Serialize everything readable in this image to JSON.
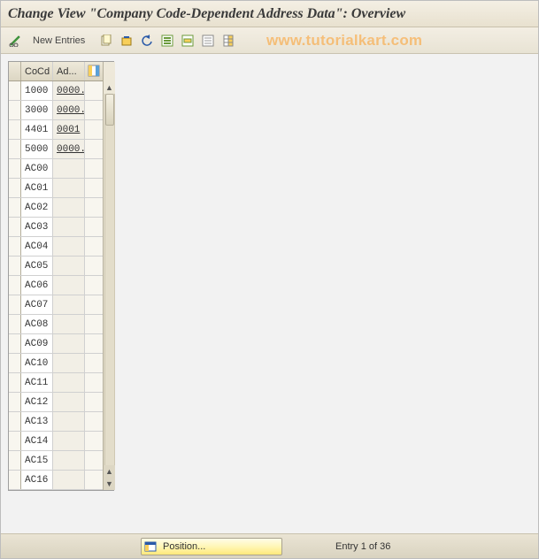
{
  "title": "Change View \"Company Code-Dependent Address Data\": Overview",
  "watermark": "www.tutorialkart.com",
  "toolbar": {
    "new_entries_label": "New Entries"
  },
  "table": {
    "columns": {
      "sel": "",
      "cocd": "CoCd",
      "ad": "Ad..."
    },
    "rows": [
      {
        "cocd": "1000",
        "ad": "0000."
      },
      {
        "cocd": "3000",
        "ad": "0000."
      },
      {
        "cocd": "4401",
        "ad": "0001"
      },
      {
        "cocd": "5000",
        "ad": "0000."
      },
      {
        "cocd": "AC00",
        "ad": ""
      },
      {
        "cocd": "AC01",
        "ad": ""
      },
      {
        "cocd": "AC02",
        "ad": ""
      },
      {
        "cocd": "AC03",
        "ad": ""
      },
      {
        "cocd": "AC04",
        "ad": ""
      },
      {
        "cocd": "AC05",
        "ad": ""
      },
      {
        "cocd": "AC06",
        "ad": ""
      },
      {
        "cocd": "AC07",
        "ad": ""
      },
      {
        "cocd": "AC08",
        "ad": ""
      },
      {
        "cocd": "AC09",
        "ad": ""
      },
      {
        "cocd": "AC10",
        "ad": ""
      },
      {
        "cocd": "AC11",
        "ad": ""
      },
      {
        "cocd": "AC12",
        "ad": ""
      },
      {
        "cocd": "AC13",
        "ad": ""
      },
      {
        "cocd": "AC14",
        "ad": ""
      },
      {
        "cocd": "AC15",
        "ad": ""
      },
      {
        "cocd": "AC16",
        "ad": ""
      }
    ]
  },
  "footer": {
    "position_label": "Position...",
    "entry_info": "Entry 1 of 36"
  }
}
